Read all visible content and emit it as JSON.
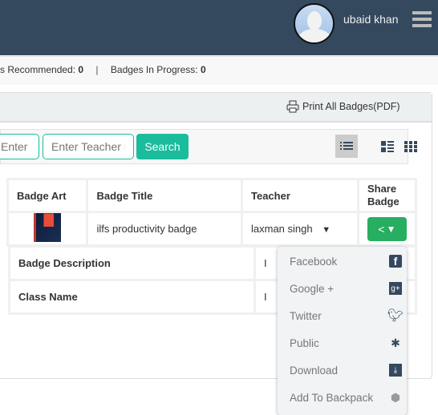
{
  "header": {
    "user_name": "ubaid khan"
  },
  "stats": {
    "recommended_label": "s Recommended:",
    "recommended_value": "0",
    "separator": "|",
    "in_progress_label": "Badges In Progress:",
    "in_progress_value": "0"
  },
  "panel": {
    "print_label": "Print All Badges(PDF)"
  },
  "filter": {
    "class_placeholder": "Enter Class Name",
    "teacher_placeholder": "Enter Teacher Name",
    "search_label": "Search"
  },
  "table": {
    "headers": [
      "Badge Art",
      "Badge Title",
      "Teacher",
      "Share Badge"
    ],
    "row": {
      "title": "ilfs productivity badge",
      "teacher": "laxman singh"
    }
  },
  "details": [
    {
      "label": "Badge Description",
      "value": "I"
    },
    {
      "label": "Class Name",
      "value": "I"
    }
  ],
  "share_menu": [
    {
      "label": "Facebook",
      "icon": "facebook-icon"
    },
    {
      "label": "Google +",
      "icon": "google-plus-icon"
    },
    {
      "label": "Twitter",
      "icon": "twitter-icon"
    },
    {
      "label": "Public",
      "icon": "public-icon"
    },
    {
      "label": "Download",
      "icon": "pdf-download-icon"
    },
    {
      "label": "Add To Backpack",
      "icon": "backpack-icon"
    }
  ],
  "colors": {
    "header": "#34495e",
    "accent": "#1abc9c",
    "share": "#27ae60"
  }
}
